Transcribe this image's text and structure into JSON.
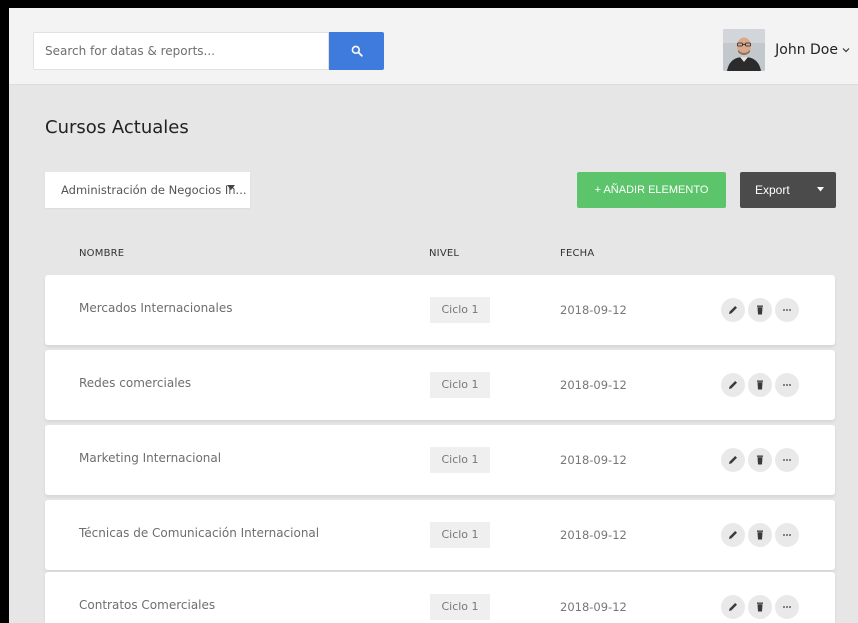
{
  "search": {
    "placeholder": "Search for datas & reports..."
  },
  "user": {
    "name": "John Doe"
  },
  "page": {
    "title": "Cursos Actuales"
  },
  "filter": {
    "selected": "Administración de Negocios In..."
  },
  "toolbar": {
    "add_label": "+ AÑADIR ELEMENTO",
    "export_label": "Export"
  },
  "table": {
    "headers": {
      "name": "NOMBRE",
      "level": "NIVEL",
      "date": "FECHA"
    },
    "rows": [
      {
        "name": "Mercados Internacionales",
        "level": "Ciclo 1",
        "date": "2018-09-12"
      },
      {
        "name": "Redes comerciales",
        "level": "Ciclo 1",
        "date": "2018-09-12"
      },
      {
        "name": "Marketing Internacional",
        "level": "Ciclo 1",
        "date": "2018-09-12"
      },
      {
        "name": "Técnicas de Comunicación Internacional",
        "level": "Ciclo 1",
        "date": "2018-09-12"
      },
      {
        "name": "Contratos Comerciales",
        "level": "Ciclo 1",
        "date": "2018-09-12"
      }
    ]
  },
  "icons": {
    "search": "search-icon",
    "caret": "chevron-down-icon",
    "edit": "pencil-icon",
    "delete": "trash-icon",
    "more": "more-icon"
  },
  "colors": {
    "accent_blue": "#3f7bdc",
    "add_green": "#5cc46a",
    "export_dark": "#4b4b4b",
    "background": "#e6e6e6"
  }
}
